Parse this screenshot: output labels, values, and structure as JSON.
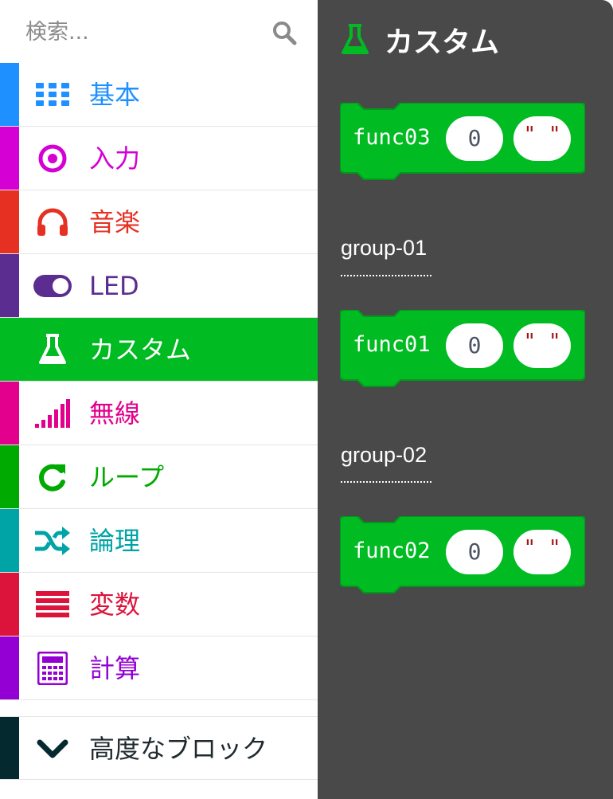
{
  "search": {
    "placeholder": "検索..."
  },
  "categories": [
    {
      "label": "基本",
      "color": "#1e90ff",
      "icon": "grid-icon"
    },
    {
      "label": "入力",
      "color": "#d400d4",
      "icon": "target-icon"
    },
    {
      "label": "音楽",
      "color": "#e63022",
      "icon": "headphones-icon"
    },
    {
      "label": "LED",
      "color": "#5c2d91",
      "icon": "toggle-icon"
    },
    {
      "label": "カスタム",
      "color": "#00bb21",
      "icon": "flask-icon",
      "selected": true
    },
    {
      "label": "無線",
      "color": "#e3008c",
      "icon": "signal-bars-icon"
    },
    {
      "label": "ループ",
      "color": "#00aa00",
      "icon": "refresh-icon"
    },
    {
      "label": "論理",
      "color": "#00a4a6",
      "icon": "shuffle-icon"
    },
    {
      "label": "変数",
      "color": "#dc143c",
      "icon": "list-icon"
    },
    {
      "label": "計算",
      "color": "#9400d3",
      "icon": "calculator-icon"
    }
  ],
  "advanced": {
    "label": "高度なブロック",
    "icon": "chevron-down-icon"
  },
  "flyout": {
    "title": "カスタム",
    "accent": "#00bb21",
    "blocks": [
      {
        "name": "func03",
        "num": "0",
        "str": "\" \""
      },
      {
        "name": "func01",
        "num": "0",
        "str": "\" \""
      },
      {
        "name": "func02",
        "num": "0",
        "str": "\" \""
      }
    ],
    "groups": [
      "group-01",
      "group-02"
    ]
  }
}
